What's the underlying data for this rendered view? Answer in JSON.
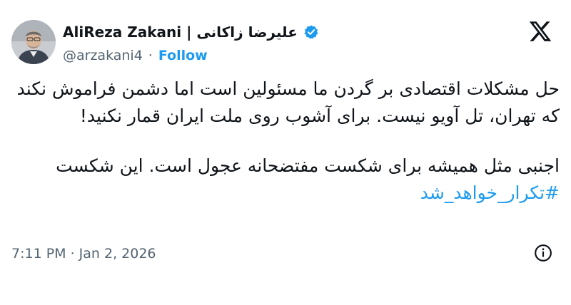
{
  "author": {
    "display_name": "AliReza Zakani | علیرضا زاکانی",
    "handle": "@arzakani4",
    "separator": "·",
    "follow_label": "Follow",
    "verified_icon": "verified-badge-icon"
  },
  "tweet": {
    "paragraph1": "حل مشکلات اقتصادی بر گردن ما مسئولین است اما دشمن فراموش نکند که تهران، تل آویو نیست. برای آشوب روی ملت ایران قمار نکنید!",
    "paragraph2_text": "اجنبی مثل همیشه برای شکست مفتضحانه عجول است. این شکست ",
    "hashtag": "#تکرار_خواهد_شد",
    "timestamp": "7:11 PM · Jan 2, 2026"
  },
  "icons": {
    "logo": "x-logo-icon",
    "info": "info-icon"
  },
  "colors": {
    "accent": "#1d9bf0",
    "text": "#0f1419",
    "muted": "#536471"
  }
}
